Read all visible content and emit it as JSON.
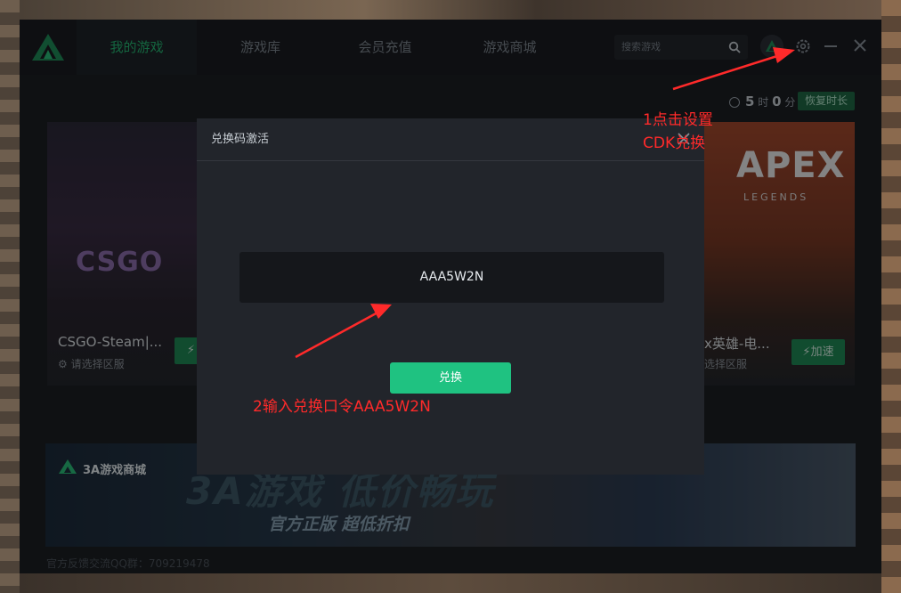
{
  "nav": {
    "tabs": [
      {
        "label": "我的游戏",
        "active": true
      },
      {
        "label": "游戏库",
        "active": false
      },
      {
        "label": "会员充值",
        "active": false
      },
      {
        "label": "游戏商城",
        "active": false
      }
    ]
  },
  "search": {
    "placeholder": "搜索游戏"
  },
  "timer": {
    "hours": "5",
    "hours_unit": "时",
    "minutes": "0",
    "minutes_unit": "分",
    "restore_label": "恢复时长"
  },
  "games": [
    {
      "title": "CSGO-Steam|...",
      "region": "请选择区服",
      "logo_text": "CSGO"
    },
    {
      "title": "x英雄-电...",
      "region": "选择区服",
      "logo_text": "APEX",
      "logo_sub": "LEGENDS",
      "accel_label": "加速"
    }
  ],
  "banner": {
    "brand": "3A游戏商城",
    "headline": "3A游戏 低价畅玩",
    "sub": "官方正版  超低折扣"
  },
  "footer": {
    "qq_text": "官方反馈交流QQ群：709219478"
  },
  "dialog": {
    "title": "兑换码激活",
    "code": "AAA5W2N",
    "button": "兑换"
  },
  "annotations": {
    "step1_line1": "1点击设置",
    "step1_line2": "CDK兑换",
    "step2": "2输入兑换口令AAA5W2N"
  },
  "colors": {
    "accent": "#25b874",
    "button": "#1fc281",
    "annotation": "#ff2a2a"
  }
}
